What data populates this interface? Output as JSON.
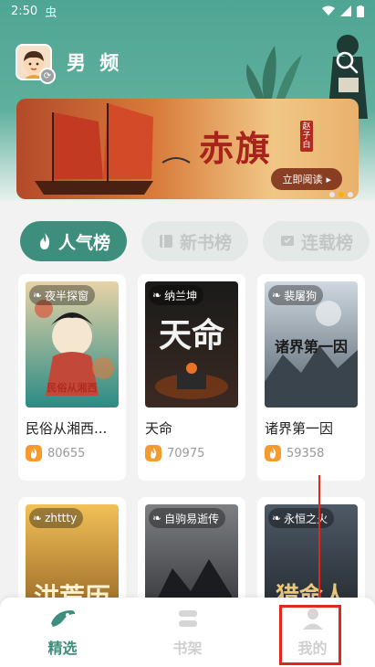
{
  "status_bar": {
    "time": "2:50",
    "extra_icon": "虫",
    "icons": [
      "wifi-icon",
      "signal-icon",
      "battery-icon"
    ]
  },
  "header": {
    "channel": "男 频",
    "avatar_icon": "boy-avatar",
    "switch_icon": "swap-icon",
    "search_icon": "search-icon"
  },
  "banner": {
    "title": "赤旗",
    "author": "赵子白",
    "cta": "立即阅读",
    "slides": 3,
    "active_slide": 2
  },
  "ranking_tabs": [
    {
      "label": "人气榜",
      "icon": "flame-icon",
      "active": true
    },
    {
      "label": "新书榜",
      "icon": "book-icon",
      "active": false
    },
    {
      "label": "连载榜",
      "icon": "update-icon",
      "active": false
    }
  ],
  "books": [
    {
      "author": "夜半探窗",
      "title": "民俗从湘西...",
      "heat": "80655",
      "cover_text": "民俗从湘西",
      "cover_colors": [
        "#e8d3a8",
        "#2a8b85"
      ]
    },
    {
      "author": "纳兰坤",
      "title": "天命",
      "heat": "70975",
      "cover_text": "天命",
      "cover_colors": [
        "#1a1a1a",
        "#3b2a22"
      ]
    },
    {
      "author": "裴屠狗",
      "title": "诸界第一因",
      "heat": "59358",
      "cover_text": "诸界第一因",
      "cover_colors": [
        "#cfd8e0",
        "#52606b"
      ]
    },
    {
      "author": "zhttty",
      "title": "",
      "heat": "",
      "cover_text": "洪荒历",
      "cover_colors": [
        "#f2c157",
        "#8a5a20"
      ]
    },
    {
      "author": "自驹易逝传",
      "title": "",
      "heat": "",
      "cover_text": "",
      "cover_colors": [
        "#7d8083",
        "#2a2b2e"
      ]
    },
    {
      "author": "永恒之火",
      "title": "",
      "heat": "",
      "cover_text": "猎命人",
      "cover_colors": [
        "#4e5a66",
        "#1e2329"
      ]
    }
  ],
  "bottom_nav": [
    {
      "label": "精选",
      "icon": "featured-icon",
      "active": true
    },
    {
      "label": "书架",
      "icon": "bookshelf-icon",
      "active": false
    },
    {
      "label": "我的",
      "icon": "profile-icon",
      "active": false
    }
  ],
  "colors": {
    "accent": "#3d8e7c",
    "header": "#4fa593",
    "highlight": "#e1261c"
  }
}
